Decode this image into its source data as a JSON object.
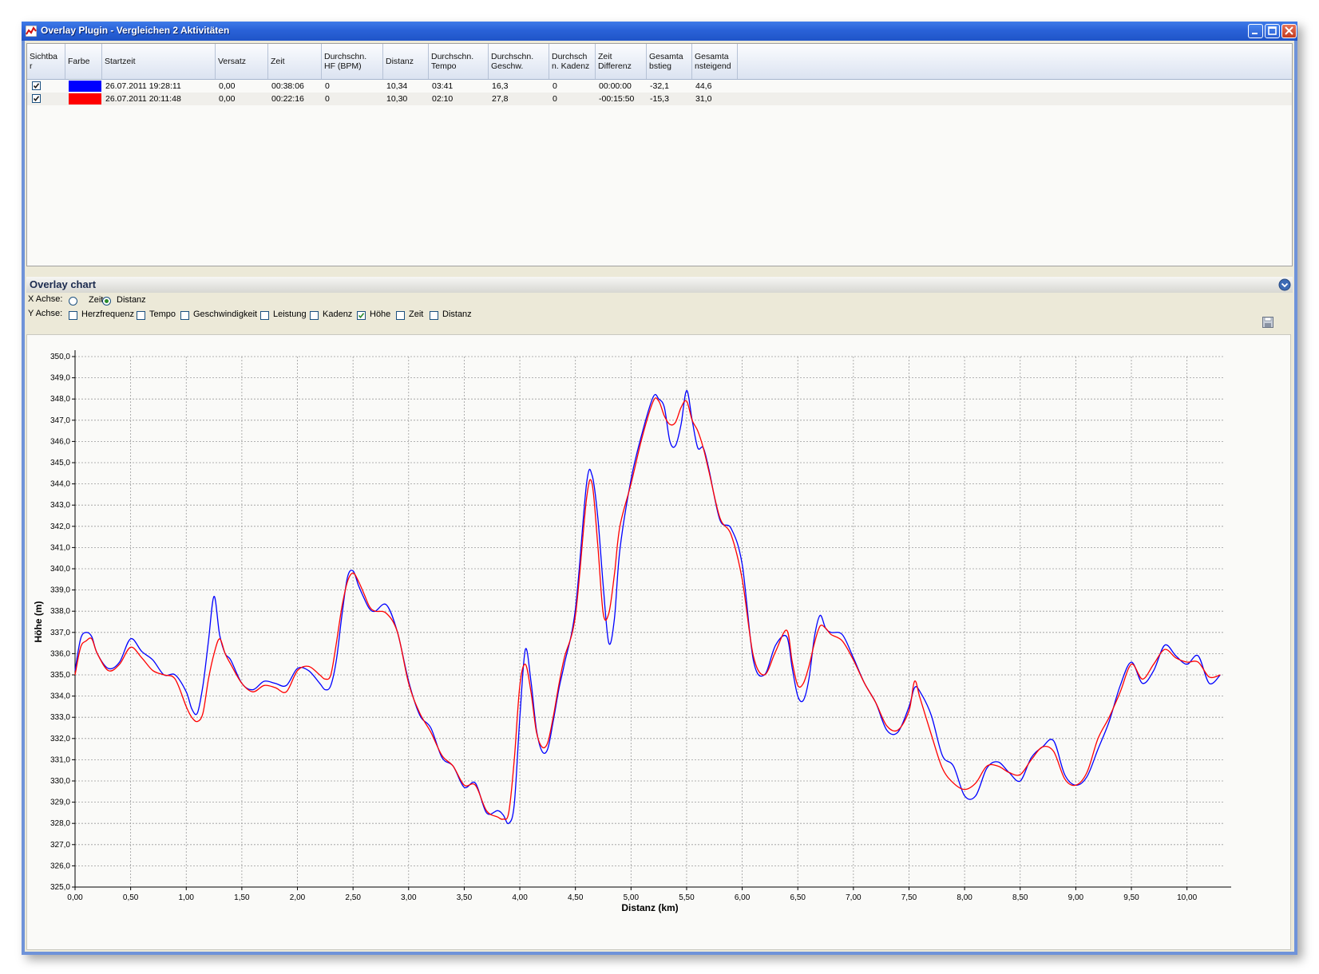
{
  "window": {
    "title": "Overlay Plugin - Vergleichen 2 Aktivitäten"
  },
  "grid": {
    "columns": [
      {
        "label": "Sichtba r"
      },
      {
        "label": "Farbe"
      },
      {
        "label": "Startzeit"
      },
      {
        "label": "Versatz"
      },
      {
        "label": "Zeit"
      },
      {
        "label": "Durchschn. HF (BPM)"
      },
      {
        "label": "Distanz"
      },
      {
        "label": "Durchschn. Tempo"
      },
      {
        "label": "Durchschn. Geschw."
      },
      {
        "label": "Durchsch n. Kadenz"
      },
      {
        "label": "Zeit Differenz"
      },
      {
        "label": "Gesamta bstieg"
      },
      {
        "label": "Gesamta nsteigend"
      }
    ],
    "rows": [
      {
        "visible": true,
        "color": "#0000ff",
        "startzeit": "26.07.2011 19:28:11",
        "versatz": "0,00",
        "zeit": "00:38:06",
        "hf": "0",
        "distanz": "10,34",
        "tempo": "03:41",
        "geschw": "16,3",
        "kadenz": "0",
        "zeit_diff": "00:00:00",
        "abstieg": "-32,1",
        "anstieg": "44,6"
      },
      {
        "visible": true,
        "color": "#ff0000",
        "startzeit": "26.07.2011 20:11:48",
        "versatz": "0,00",
        "zeit": "00:22:16",
        "hf": "0",
        "distanz": "10,30",
        "tempo": "02:10",
        "geschw": "27,8",
        "kadenz": "0",
        "zeit_diff": "-00:15:50",
        "abstieg": "-15,3",
        "anstieg": "31,0"
      }
    ]
  },
  "overlay_panel": {
    "title": "Overlay chart",
    "x_axis_label": "X Achse:",
    "x_options": [
      {
        "label": "Zeit",
        "selected": false
      },
      {
        "label": "Distanz",
        "selected": true
      }
    ],
    "y_axis_label": "Y Achse:",
    "y_options": [
      {
        "label": "Herzfrequenz",
        "checked": false
      },
      {
        "label": "Tempo",
        "checked": false
      },
      {
        "label": "Geschwindigkeit",
        "checked": false
      },
      {
        "label": "Leistung",
        "checked": false
      },
      {
        "label": "Kadenz",
        "checked": false
      },
      {
        "label": "Höhe",
        "checked": true
      },
      {
        "label": "Zeit",
        "checked": false
      },
      {
        "label": "Distanz",
        "checked": false
      }
    ]
  },
  "chart_data": {
    "type": "line",
    "title": "",
    "xlabel": "Distanz (km)",
    "ylabel": "Höhe (m)",
    "xlim": [
      0,
      10.34
    ],
    "ylim": [
      325,
      350
    ],
    "x_ticks": [
      "0,00",
      "0,50",
      "1,00",
      "1,50",
      "2,00",
      "2,50",
      "3,00",
      "3,50",
      "4,00",
      "4,50",
      "5,00",
      "5,50",
      "6,00",
      "6,50",
      "7,00",
      "7,50",
      "8,00",
      "8,50",
      "9,00",
      "9,50",
      "10,00"
    ],
    "y_ticks": [
      "325,0",
      "326,0",
      "327,0",
      "328,0",
      "329,0",
      "330,0",
      "331,0",
      "332,0",
      "333,0",
      "334,0",
      "335,0",
      "336,0",
      "337,0",
      "338,0",
      "339,0",
      "340,0",
      "341,0",
      "342,0",
      "343,0",
      "344,0",
      "345,0",
      "346,0",
      "347,0",
      "348,0",
      "349,0",
      "350,0"
    ],
    "grid": true,
    "series": [
      {
        "color": "#0000ff",
        "x": [
          0.0,
          0.05,
          0.1,
          0.15,
          0.2,
          0.3,
          0.4,
          0.5,
          0.6,
          0.7,
          0.8,
          0.9,
          1.0,
          1.05,
          1.1,
          1.15,
          1.2,
          1.25,
          1.3,
          1.35,
          1.4,
          1.5,
          1.6,
          1.7,
          1.8,
          1.9,
          2.0,
          2.1,
          2.2,
          2.25,
          2.3,
          2.35,
          2.4,
          2.45,
          2.5,
          2.55,
          2.6,
          2.65,
          2.7,
          2.8,
          2.9,
          3.0,
          3.1,
          3.2,
          3.3,
          3.4,
          3.5,
          3.6,
          3.7,
          3.8,
          3.85,
          3.9,
          3.95,
          4.0,
          4.05,
          4.1,
          4.15,
          4.2,
          4.25,
          4.3,
          4.35,
          4.4,
          4.5,
          4.6,
          4.65,
          4.7,
          4.75,
          4.8,
          4.85,
          4.9,
          5.0,
          5.1,
          5.2,
          5.25,
          5.3,
          5.35,
          5.4,
          5.45,
          5.5,
          5.55,
          5.6,
          5.65,
          5.7,
          5.8,
          5.9,
          6.0,
          6.1,
          6.2,
          6.3,
          6.4,
          6.45,
          6.5,
          6.55,
          6.6,
          6.65,
          6.7,
          6.75,
          6.8,
          6.9,
          7.0,
          7.1,
          7.2,
          7.3,
          7.4,
          7.5,
          7.55,
          7.6,
          7.7,
          7.8,
          7.9,
          8.0,
          8.1,
          8.2,
          8.3,
          8.4,
          8.5,
          8.6,
          8.7,
          8.8,
          8.9,
          9.0,
          9.1,
          9.2,
          9.3,
          9.4,
          9.5,
          9.6,
          9.7,
          9.8,
          9.9,
          10.0,
          10.1,
          10.2,
          10.3
        ],
        "y": [
          335.2,
          336.7,
          337.0,
          336.8,
          336.0,
          335.3,
          335.6,
          336.7,
          336.1,
          335.7,
          335.0,
          335.0,
          334.2,
          333.4,
          333.2,
          334.5,
          336.6,
          338.7,
          336.9,
          336.0,
          335.7,
          334.6,
          334.3,
          334.7,
          334.6,
          334.5,
          335.3,
          335.2,
          334.6,
          334.3,
          334.5,
          335.7,
          337.8,
          339.6,
          339.9,
          339.2,
          338.6,
          338.1,
          338.0,
          338.3,
          337.0,
          334.7,
          333.1,
          332.5,
          331.1,
          330.7,
          329.7,
          329.9,
          328.5,
          328.6,
          328.4,
          328.0,
          328.9,
          333.0,
          336.2,
          334.7,
          332.4,
          331.4,
          331.5,
          332.8,
          334.3,
          335.5,
          338.1,
          344.0,
          344.4,
          342.5,
          339.2,
          336.5,
          337.6,
          340.9,
          344.2,
          346.4,
          348.1,
          348.0,
          347.6,
          346.0,
          345.8,
          346.8,
          348.4,
          347.0,
          345.7,
          345.7,
          344.7,
          342.3,
          341.9,
          340.2,
          335.7,
          335.0,
          336.4,
          336.8,
          335.3,
          334.0,
          333.8,
          334.8,
          336.8,
          337.8,
          337.2,
          337.0,
          336.9,
          335.8,
          334.6,
          333.7,
          332.4,
          332.3,
          333.5,
          334.4,
          334.2,
          333.1,
          331.2,
          330.7,
          329.3,
          329.3,
          330.6,
          330.9,
          330.4,
          330.0,
          331.1,
          331.6,
          331.9,
          330.3,
          329.8,
          330.2,
          331.5,
          332.8,
          334.5,
          335.6,
          334.6,
          335.2,
          336.4,
          335.9,
          335.5,
          335.9,
          334.6,
          335.0
        ]
      },
      {
        "color": "#ff0000",
        "x": [
          0.0,
          0.05,
          0.1,
          0.15,
          0.2,
          0.3,
          0.4,
          0.5,
          0.6,
          0.7,
          0.8,
          0.9,
          1.0,
          1.05,
          1.1,
          1.15,
          1.2,
          1.25,
          1.3,
          1.35,
          1.4,
          1.5,
          1.6,
          1.7,
          1.8,
          1.9,
          2.0,
          2.1,
          2.2,
          2.25,
          2.3,
          2.35,
          2.4,
          2.45,
          2.5,
          2.55,
          2.6,
          2.65,
          2.7,
          2.8,
          2.9,
          3.0,
          3.1,
          3.2,
          3.3,
          3.4,
          3.5,
          3.6,
          3.7,
          3.8,
          3.85,
          3.9,
          3.95,
          4.0,
          4.05,
          4.1,
          4.15,
          4.2,
          4.25,
          4.3,
          4.35,
          4.4,
          4.5,
          4.6,
          4.65,
          4.7,
          4.75,
          4.8,
          4.85,
          4.9,
          5.0,
          5.1,
          5.2,
          5.25,
          5.3,
          5.35,
          5.4,
          5.45,
          5.5,
          5.55,
          5.6,
          5.65,
          5.7,
          5.8,
          5.9,
          6.0,
          6.1,
          6.2,
          6.3,
          6.4,
          6.45,
          6.5,
          6.55,
          6.6,
          6.65,
          6.7,
          6.75,
          6.8,
          6.9,
          7.0,
          7.1,
          7.2,
          7.3,
          7.4,
          7.5,
          7.55,
          7.6,
          7.7,
          7.8,
          7.9,
          8.0,
          8.1,
          8.2,
          8.3,
          8.4,
          8.5,
          8.6,
          8.7,
          8.8,
          8.9,
          9.0,
          9.1,
          9.2,
          9.3,
          9.4,
          9.5,
          9.6,
          9.7,
          9.8,
          9.9,
          10.0,
          10.1,
          10.2,
          10.3
        ],
        "y": [
          335.0,
          336.3,
          336.6,
          336.7,
          336.0,
          335.2,
          335.5,
          336.3,
          335.8,
          335.2,
          335.0,
          334.8,
          333.5,
          333.0,
          332.8,
          333.2,
          334.8,
          336.0,
          336.7,
          336.0,
          335.5,
          334.6,
          334.2,
          334.5,
          334.4,
          334.2,
          335.2,
          335.4,
          335.0,
          334.8,
          335.0,
          336.5,
          338.2,
          339.4,
          339.8,
          339.4,
          338.8,
          338.2,
          338.0,
          337.9,
          337.0,
          334.6,
          333.2,
          332.3,
          331.2,
          330.7,
          329.8,
          329.8,
          328.6,
          328.3,
          328.2,
          328.5,
          331.0,
          334.5,
          335.5,
          334.2,
          332.3,
          331.6,
          331.8,
          333.0,
          334.5,
          335.8,
          337.8,
          343.3,
          344.0,
          341.2,
          337.9,
          337.9,
          339.7,
          342.0,
          344.0,
          346.2,
          347.9,
          347.9,
          347.2,
          346.8,
          346.9,
          347.6,
          347.9,
          347.0,
          346.5,
          345.7,
          344.6,
          342.4,
          341.6,
          339.5,
          335.9,
          335.0,
          336.1,
          337.1,
          335.6,
          334.5,
          334.6,
          335.4,
          336.5,
          337.3,
          337.2,
          336.9,
          336.6,
          335.7,
          334.6,
          333.7,
          332.6,
          332.4,
          333.3,
          334.7,
          333.9,
          332.2,
          330.6,
          329.9,
          329.6,
          329.9,
          330.7,
          330.7,
          330.4,
          330.3,
          331.0,
          331.6,
          331.4,
          330.1,
          329.8,
          330.4,
          332.0,
          333.0,
          334.2,
          335.5,
          334.8,
          335.5,
          336.2,
          335.8,
          335.6,
          335.6,
          334.9,
          335.0
        ]
      }
    ]
  }
}
